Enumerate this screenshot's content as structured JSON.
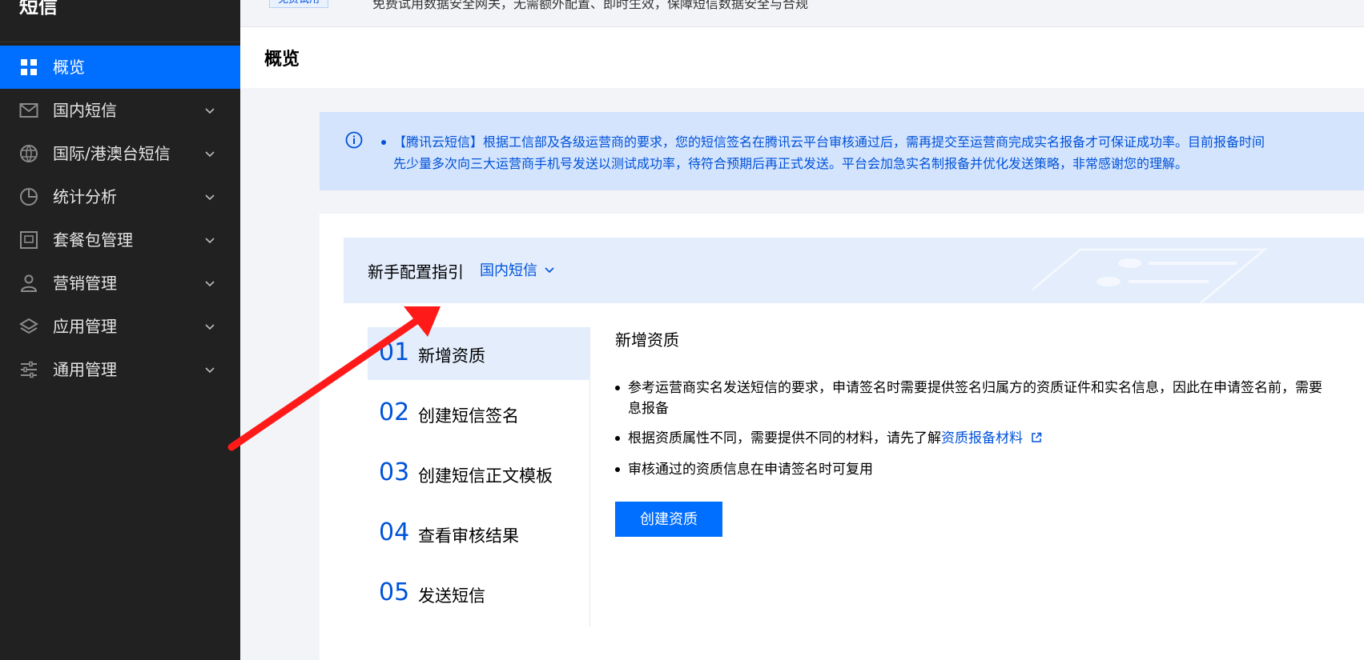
{
  "sidebar": {
    "title": "短信",
    "items": [
      {
        "label": "概览",
        "icon": "grid-icon",
        "active": true
      },
      {
        "label": "国内短信",
        "icon": "mail-icon"
      },
      {
        "label": "国际/港澳台短信",
        "icon": "globe-icon"
      },
      {
        "label": "统计分析",
        "icon": "pie-chart-icon"
      },
      {
        "label": "套餐包管理",
        "icon": "package-icon"
      },
      {
        "label": "营销管理",
        "icon": "user-icon"
      },
      {
        "label": "应用管理",
        "icon": "layers-icon"
      },
      {
        "label": "通用管理",
        "icon": "sliders-icon"
      }
    ]
  },
  "top_notice": {
    "badge": "免费试用",
    "text": "免费试用数据安全网关，无需额外配置、即时生效，保障短信数据安全与合规"
  },
  "header": {
    "title": "概览"
  },
  "alert": {
    "line1": "【腾讯云短信】根据工信部及各级运营商的要求，您的短信签名在腾讯云平台审核通过后，需再提交至运营商完成实名报备才可保证成功率。目前报备时间",
    "line2": "先少量多次向三大运营商手机号发送以测试成功率，待符合预期后再正式发送。平台会加急实名制报备并优化发送策略，非常感谢您的理解。"
  },
  "guide": {
    "title": "新手配置指引",
    "select_value": "国内短信",
    "steps": [
      {
        "num": "01",
        "label": "新增资质",
        "active": true
      },
      {
        "num": "02",
        "label": "创建短信签名"
      },
      {
        "num": "03",
        "label": "创建短信正文模板"
      },
      {
        "num": "04",
        "label": "查看审核结果"
      },
      {
        "num": "05",
        "label": "发送短信"
      }
    ],
    "detail": {
      "title": "新增资质",
      "bullet1_line1": "参考运营商实名发送短信的要求，申请签名时需要提供签名归属方的资质证件和实名信息，因此在申请签名前，需要",
      "bullet1_line2": "息报备",
      "bullet2_text": "根据资质属性不同，需要提供不同的材料，请先了解",
      "bullet2_link": "资质报备材料",
      "bullet3": "审核通过的资质信息在申请签名时可复用",
      "button": "创建资质"
    }
  },
  "colors": {
    "sidebar_bg": "#212121",
    "active": "#006eff",
    "link": "#0052d9",
    "alert_bg": "#d4e4fd",
    "annotation_arrow": "#ff1a1a"
  }
}
